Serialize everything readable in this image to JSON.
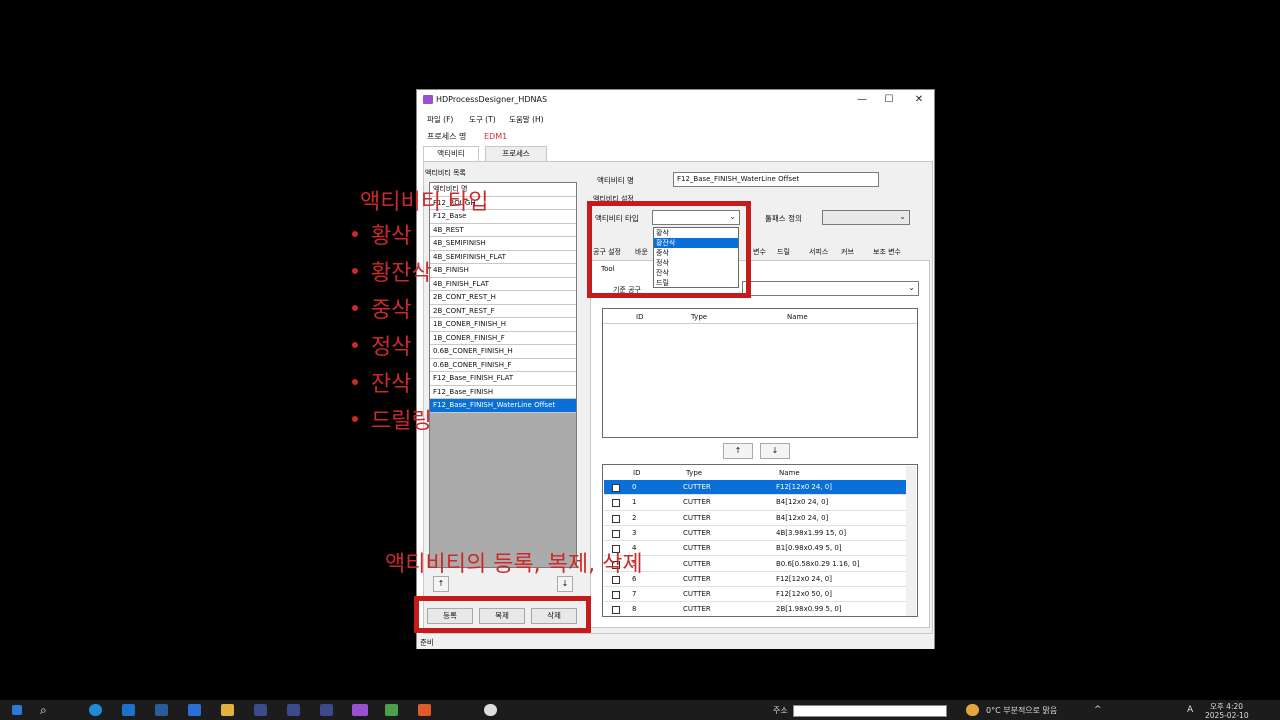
{
  "window": {
    "title": "HDProcessDesigner_HDNAS",
    "minimize": "—",
    "maximize": "☐",
    "close": "✕"
  },
  "menu": [
    "파일 (F)",
    "도구 (T)",
    "도움말 (H)"
  ],
  "process": {
    "label": "프로세스 명",
    "value": "EDM1"
  },
  "top_tabs": [
    "액티비티",
    "프로세스"
  ],
  "activity_list": {
    "label": "액티비티 목록",
    "items": [
      "액티비티 명",
      "F12_ROUGH",
      "F12_Base",
      "4B_REST",
      "4B_SEMIFINISH",
      "4B_SEMIFINISH_FLAT",
      "4B_FINISH",
      "4B_FINISH_FLAT",
      "2B_CONT_REST_H",
      "2B_CONT_REST_F",
      "1B_CONER_FINISH_H",
      "1B_CONER_FINISH_F",
      "0.6B_CONER_FINISH_H",
      "0.6B_CONER_FINISH_F",
      "F12_Base_FINISH_FLAT",
      "F12_Base_FINISH",
      "F12_Base_FINISH_WaterLine Offset"
    ],
    "selected_index": 16,
    "up_arrow": "↑",
    "down_arrow": "↓"
  },
  "buttons": {
    "register": "등록",
    "copy": "복제",
    "delete": "삭제"
  },
  "activity_name": {
    "label": "액티비티 명",
    "value": "F12_Base_FINISH_WaterLine Offset"
  },
  "activity_settings": {
    "label": "액티비티 설정",
    "type_label": "액티비티 타입",
    "toolpath_label": "툴패스 정의"
  },
  "type_options": [
    "황삭",
    "황잔삭",
    "중삭",
    "정삭",
    "잔삭",
    "드릴"
  ],
  "type_highlighted_index": 1,
  "inner_tabs": [
    "공구 설정",
    "바운",
    "변수",
    "드릴",
    "서피스",
    "커브",
    "보조 변수"
  ],
  "tool": {
    "group_label": "Tool",
    "ref_label": "기준 공구"
  },
  "top_grid_headers": [
    "ID",
    "Type",
    "Name"
  ],
  "move_up": "↑",
  "move_down": "↓",
  "tool_table": {
    "headers": [
      "ID",
      "Type",
      "Name"
    ],
    "rows": [
      {
        "id": "0",
        "type": "CUTTER",
        "name": "F12[12x0 24, 0]"
      },
      {
        "id": "1",
        "type": "CUTTER",
        "name": "B4[12x0 24, 0]"
      },
      {
        "id": "2",
        "type": "CUTTER",
        "name": "B4[12x0 24, 0]"
      },
      {
        "id": "3",
        "type": "CUTTER",
        "name": "4B[3.98x1.99 15, 0]"
      },
      {
        "id": "4",
        "type": "CUTTER",
        "name": "B1[0.98x0.49 5, 0]"
      },
      {
        "id": "5",
        "type": "CUTTER",
        "name": "B0.6[0.58x0.29 1.16, 0]"
      },
      {
        "id": "6",
        "type": "CUTTER",
        "name": "F12[12x0 24, 0]"
      },
      {
        "id": "7",
        "type": "CUTTER",
        "name": "F12[12x0 50, 0]"
      },
      {
        "id": "8",
        "type": "CUTTER",
        "name": "2B[1.98x0.99 5, 0]"
      }
    ],
    "selected_index": 0
  },
  "status": "준비",
  "overlay": {
    "heading": "액티비티 타입",
    "bullets": [
      "황삭",
      "황잔삭",
      "중삭",
      "정삭",
      "잔삭",
      "드릴링"
    ],
    "caption": "액티비티의 등록, 복제, 삭제"
  },
  "taskbar": {
    "address_label": "주소",
    "weather": "0°C  부분적으로 맑음",
    "time": "오후 4:20",
    "date": "2025-02-10",
    "input_lang": "A"
  },
  "colors": {
    "selection": "#0a6fd6",
    "annotation_red": "#cc2a2a",
    "process_value": "#d03030"
  }
}
